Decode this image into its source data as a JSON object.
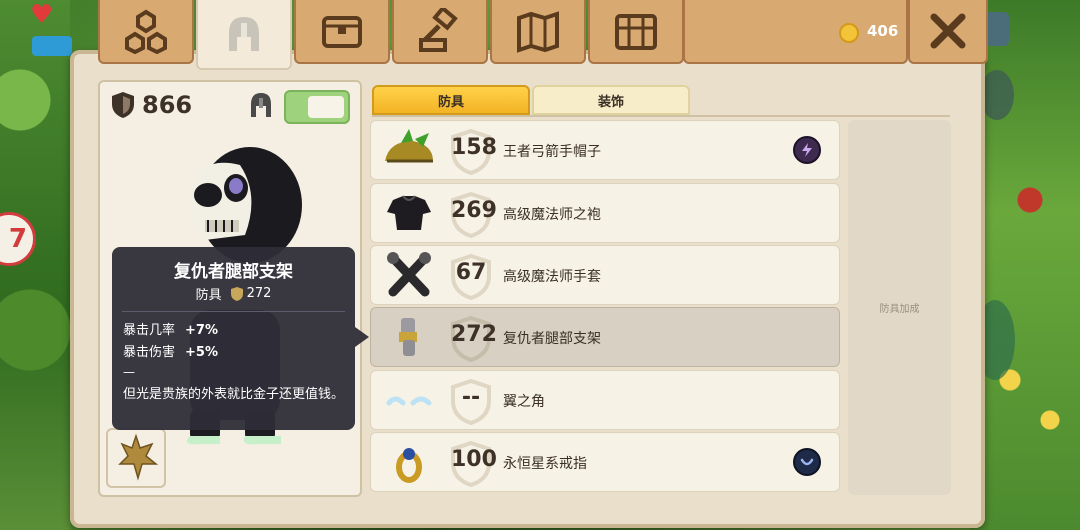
{
  "coins": "406",
  "top_tabs": [
    {
      "name": "tab-skills",
      "icon": "skill-tree-icon",
      "active": false
    },
    {
      "name": "tab-armor",
      "icon": "helmet-icon",
      "active": true
    },
    {
      "name": "tab-bag",
      "icon": "bag-icon",
      "active": false
    },
    {
      "name": "tab-craft",
      "icon": "hammer-icon",
      "active": false
    },
    {
      "name": "tab-map",
      "icon": "map-icon",
      "active": false
    },
    {
      "name": "tab-chest",
      "icon": "chest-icon",
      "active": false
    }
  ],
  "left_panel": {
    "armor_total": "866",
    "show_helmet_toggle": true
  },
  "tooltip": {
    "title": "复仇者腿部支架",
    "type": "防具",
    "armor": "272",
    "stats": [
      {
        "label": "暴击几率",
        "value": "+7%"
      },
      {
        "label": "暴击伤害",
        "value": "+5%"
      }
    ],
    "dash": "—",
    "description": "但光是贵族的外表就比金子还更值钱。"
  },
  "category_tabs": [
    {
      "label": "防具",
      "active": true
    },
    {
      "label": "装饰",
      "active": false
    }
  ],
  "items": [
    {
      "name": "王者弓箭手帽子",
      "armor": "158",
      "icon": "archer-hat-icon",
      "badge": "lightning-icon",
      "selected": false
    },
    {
      "name": "高级魔法师之袍",
      "armor": "269",
      "icon": "mage-robe-icon",
      "badge": null,
      "selected": false
    },
    {
      "name": "高级魔法师手套",
      "armor": "67",
      "icon": "mage-gloves-icon",
      "badge": null,
      "selected": false
    },
    {
      "name": "复仇者腿部支架",
      "armor": "272",
      "icon": "leg-brace-icon",
      "badge": null,
      "selected": true
    },
    {
      "name": "翼之角",
      "armor": "--",
      "icon": "wing-horn-icon",
      "badge": null,
      "selected": false
    },
    {
      "name": "永恒星系戒指",
      "armor": "100",
      "icon": "ring-icon",
      "badge": "moon-icon",
      "selected": false
    }
  ],
  "bonus_label": "防具加成",
  "colors": {
    "panel": "#e9dfcb",
    "tab": "#d8a970",
    "active_category": "#f3b325",
    "tooltip": "#2e2c37",
    "toggle_on": "#9fd27d"
  }
}
